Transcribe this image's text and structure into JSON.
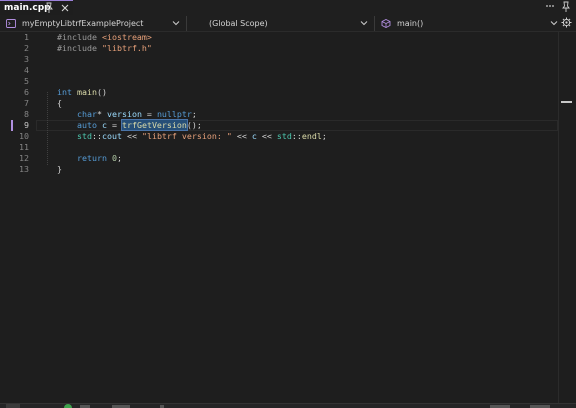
{
  "tab": {
    "title": "main.cpp"
  },
  "navbar": {
    "project": "myEmptyLibtrfExampleProject",
    "scope": "(Global Scope)",
    "function": "main()"
  },
  "editor": {
    "line_numbers": [
      "1",
      "2",
      "3",
      "4",
      "5",
      "6",
      "7",
      "8",
      "9",
      "10",
      "11",
      "12",
      "13"
    ],
    "active_line": 9,
    "lines": [
      [
        {
          "t": "#include ",
          "c": "pp"
        },
        {
          "t": "<iostream>",
          "c": "str"
        }
      ],
      [
        {
          "t": "#include ",
          "c": "pp"
        },
        {
          "t": "\"libtrf.h\"",
          "c": "str"
        }
      ],
      [],
      [],
      [],
      [
        {
          "t": "int",
          "c": "kw"
        },
        {
          "t": " ",
          "c": "pl"
        },
        {
          "t": "main",
          "c": "fn"
        },
        {
          "t": "()",
          "c": "pl"
        }
      ],
      [
        {
          "t": "{",
          "c": "pl"
        }
      ],
      [
        {
          "t": "    ",
          "c": "pl"
        },
        {
          "t": "char",
          "c": "kw"
        },
        {
          "t": "* ",
          "c": "pl"
        },
        {
          "t": "version",
          "c": "var"
        },
        {
          "t": " = ",
          "c": "pl"
        },
        {
          "t": "nullptr",
          "c": "kw"
        },
        {
          "t": ";",
          "c": "pl"
        }
      ],
      [
        {
          "t": "    ",
          "c": "pl"
        },
        {
          "t": "auto",
          "c": "kw"
        },
        {
          "t": " ",
          "c": "pl"
        },
        {
          "t": "c",
          "c": "var"
        },
        {
          "t": " = ",
          "c": "pl"
        },
        {
          "t": "trfGetVersion",
          "c": "fn sel"
        },
        {
          "t": "();",
          "c": "pl"
        }
      ],
      [
        {
          "t": "    ",
          "c": "pl"
        },
        {
          "t": "std",
          "c": "ty"
        },
        {
          "t": "::",
          "c": "pl"
        },
        {
          "t": "cout",
          "c": "var"
        },
        {
          "t": " << ",
          "c": "pl"
        },
        {
          "t": "\"libtrf version: \"",
          "c": "str"
        },
        {
          "t": " << ",
          "c": "pl"
        },
        {
          "t": "c",
          "c": "var"
        },
        {
          "t": " << ",
          "c": "pl"
        },
        {
          "t": "std",
          "c": "ty"
        },
        {
          "t": "::",
          "c": "pl"
        },
        {
          "t": "endl",
          "c": "fn"
        },
        {
          "t": ";",
          "c": "pl"
        }
      ],
      [],
      [
        {
          "t": "    ",
          "c": "pl"
        },
        {
          "t": "return",
          "c": "kw"
        },
        {
          "t": " ",
          "c": "pl"
        },
        {
          "t": "0",
          "c": "num"
        },
        {
          "t": ";",
          "c": "pl"
        }
      ],
      [
        {
          "t": "}",
          "c": "pl"
        }
      ]
    ]
  },
  "icons": {
    "pin": "pin-icon",
    "close": "close-icon",
    "overflow": "ellipsis-icon",
    "settings": "gear-icon",
    "project": "cpp-project-icon",
    "scope": "scope-icon",
    "function": "function-cube-icon"
  },
  "colors": {
    "accent": "#9b80d8",
    "background": "#1e1e1e",
    "selection": "#264f78"
  }
}
